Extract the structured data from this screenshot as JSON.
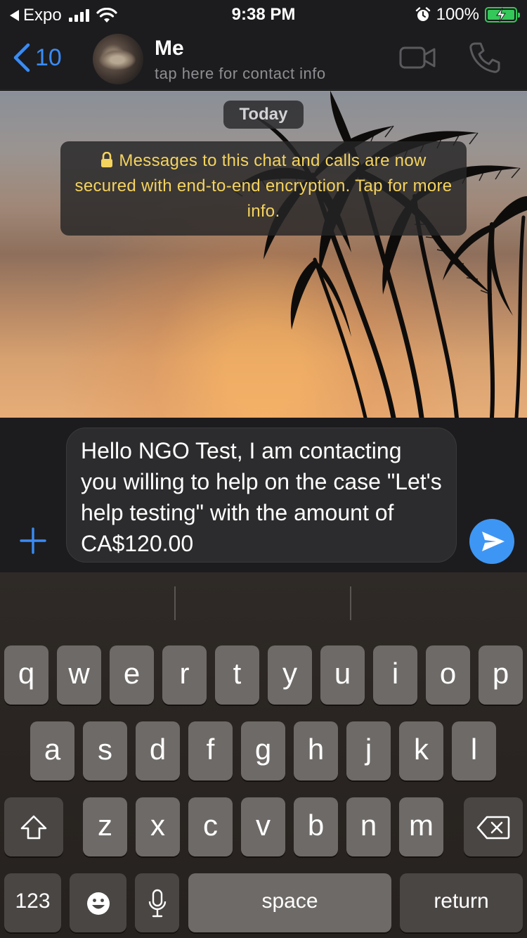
{
  "status_bar": {
    "back_app": "Expo",
    "time": "9:38 PM",
    "battery": "100%"
  },
  "header": {
    "back_count": "10",
    "contact_name": "Me",
    "contact_subtitle": "tap here for contact info"
  },
  "chat": {
    "date_chip": "Today",
    "encryption_notice": "Messages to this chat and calls are now secured with end-to-end encryption. Tap for more info."
  },
  "composer": {
    "message_text": "Hello NGO Test, I am contacting you willing to help on the case \"Let's help testing\" with the amount of CA$120.00"
  },
  "keyboard": {
    "row1": [
      "q",
      "w",
      "e",
      "r",
      "t",
      "y",
      "u",
      "i",
      "o",
      "p"
    ],
    "row2": [
      "a",
      "s",
      "d",
      "f",
      "g",
      "h",
      "j",
      "k",
      "l"
    ],
    "row3": [
      "z",
      "x",
      "c",
      "v",
      "b",
      "n",
      "m"
    ],
    "numbers_label": "123",
    "space_label": "space",
    "return_label": "return"
  },
  "colors": {
    "accent_blue": "#3a8bf5",
    "encryption_text": "#f4d35e",
    "battery_green": "#34c759"
  },
  "icons": [
    "back-chevron-icon",
    "video-call-icon",
    "phone-call-icon",
    "lock-icon",
    "plus-icon",
    "send-icon",
    "shift-icon",
    "backspace-icon",
    "emoji-icon",
    "microphone-icon"
  ]
}
